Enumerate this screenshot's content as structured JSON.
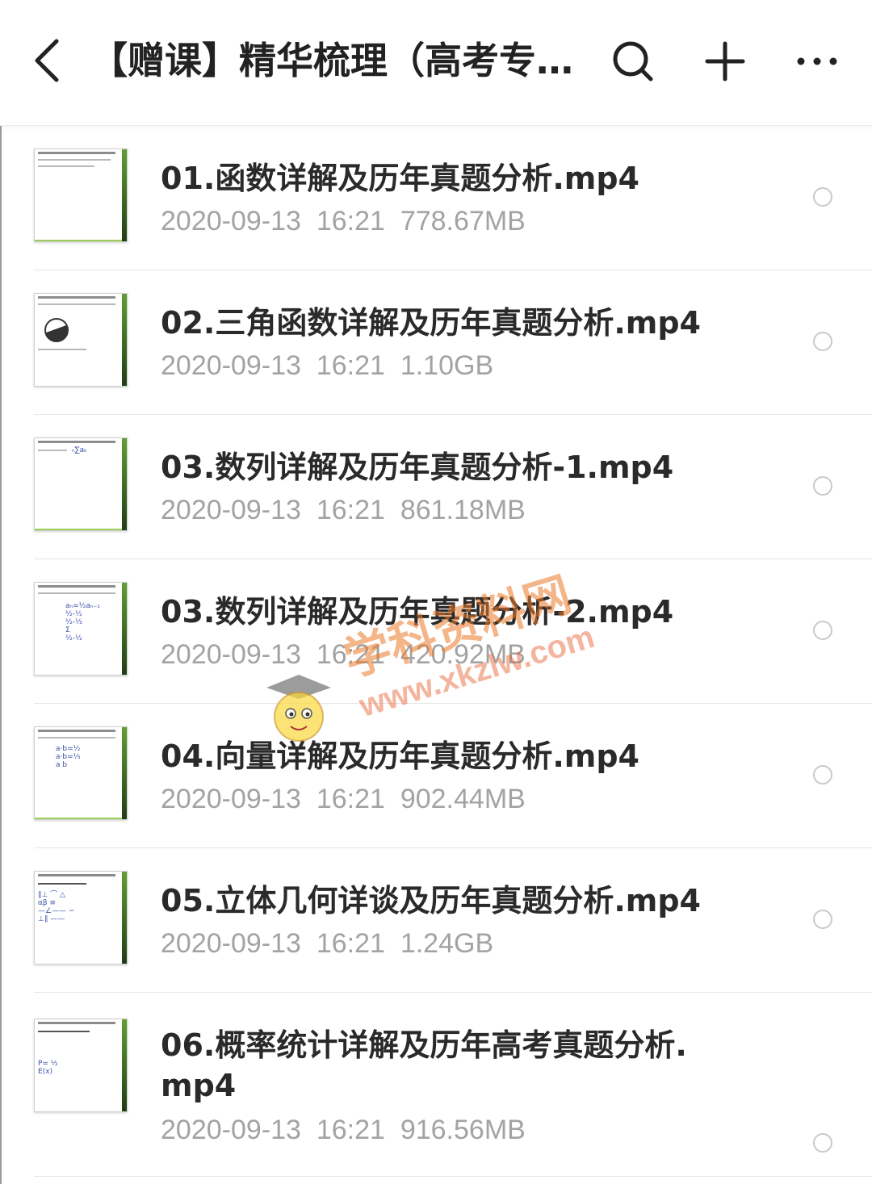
{
  "header": {
    "title": "【赠课】精华梳理（高考专…",
    "back_icon": "chevron-left-icon",
    "search_icon": "search-icon",
    "add_icon": "plus-icon",
    "more_icon": "more-icon"
  },
  "files": [
    {
      "name": "01.函数详解及历年真题分析.mp4",
      "date": "2020-09-13",
      "time": "16:21",
      "size": "778.67MB"
    },
    {
      "name": "02.三角函数详解及历年真题分析.mp4",
      "date": "2020-09-13",
      "time": "16:21",
      "size": "1.10GB"
    },
    {
      "name": "03.数列详解及历年真题分析-1.mp4",
      "date": "2020-09-13",
      "time": "16:21",
      "size": "861.18MB"
    },
    {
      "name": "03.数列详解及历年真题分析-2.mp4",
      "date": "2020-09-13",
      "time": "16:21",
      "size": "420.92MB"
    },
    {
      "name": "04.向量详解及历年真题分析.mp4",
      "date": "2020-09-13",
      "time": "16:21",
      "size": "902.44MB"
    },
    {
      "name": "05.立体几何详谈及历年真题分析.mp4",
      "date": "2020-09-13",
      "time": "16:21",
      "size": "1.24GB"
    },
    {
      "name": "06.概率统计详解及历年高考真题分析.mp4",
      "date": "2020-09-13",
      "time": "16:21",
      "size": "916.56MB"
    }
  ],
  "watermark": {
    "brand": "学科资料网",
    "url": "www.xkzlw.com"
  }
}
